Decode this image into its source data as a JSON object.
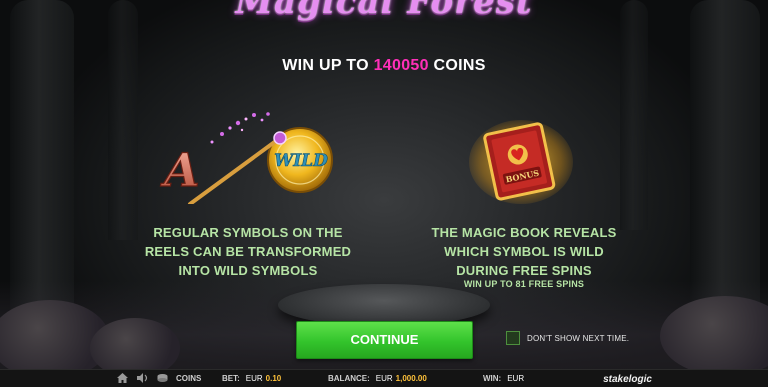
{
  "game": {
    "logo_text": "Magical Forest"
  },
  "headline": {
    "prefix": "WIN UP TO",
    "amount": "140050",
    "suffix": "COINS"
  },
  "features": {
    "left": {
      "art_letter": "A",
      "art_label": "WILD",
      "lines": [
        "REGULAR SYMBOLS ON THE",
        "REELS CAN BE TRANSFORMED",
        "INTO WILD SYMBOLS"
      ]
    },
    "right": {
      "art_label": "BONUS",
      "lines": [
        "THE MAGIC BOOK REVEALS",
        "WHICH SYMBOL IS WILD",
        "DURING FREE SPINS"
      ],
      "sub": "WIN UP TO 81 FREE SPINS"
    }
  },
  "controls": {
    "continue_label": "CONTINUE",
    "dont_show_label": "DON'T SHOW NEXT TIME.",
    "dont_show_checked": false
  },
  "bottom_bar": {
    "coins_label": "COINS",
    "bet_label": "BET:",
    "bet_currency": "EUR",
    "bet_value": "0.10",
    "balance_label": "BALANCE:",
    "balance_currency": "EUR",
    "balance_value": "1,000.00",
    "win_label": "WIN:",
    "win_currency": "EUR",
    "brand": "stakelogic",
    "icons": [
      "home-icon",
      "sound-icon",
      "coins-icon"
    ]
  },
  "colors": {
    "accent_pink": "#ff2fb8",
    "feature_text": "#b6e4a5",
    "button_green": "#33c42c",
    "value_gold": "#ffc23a"
  }
}
